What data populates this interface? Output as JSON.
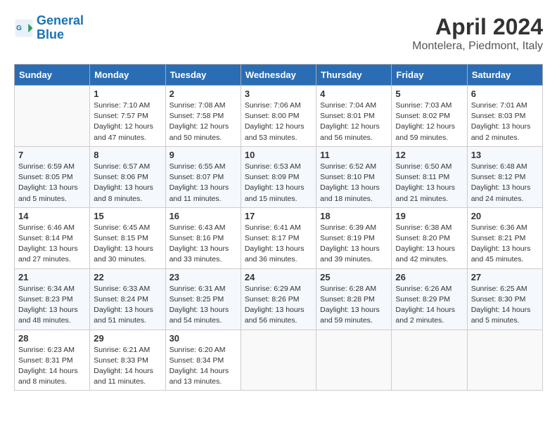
{
  "header": {
    "logo_line1": "General",
    "logo_line2": "Blue",
    "month_title": "April 2024",
    "location": "Montelera, Piedmont, Italy"
  },
  "weekdays": [
    "Sunday",
    "Monday",
    "Tuesday",
    "Wednesday",
    "Thursday",
    "Friday",
    "Saturday"
  ],
  "weeks": [
    [
      {
        "day": "",
        "info": ""
      },
      {
        "day": "1",
        "info": "Sunrise: 7:10 AM\nSunset: 7:57 PM\nDaylight: 12 hours\nand 47 minutes."
      },
      {
        "day": "2",
        "info": "Sunrise: 7:08 AM\nSunset: 7:58 PM\nDaylight: 12 hours\nand 50 minutes."
      },
      {
        "day": "3",
        "info": "Sunrise: 7:06 AM\nSunset: 8:00 PM\nDaylight: 12 hours\nand 53 minutes."
      },
      {
        "day": "4",
        "info": "Sunrise: 7:04 AM\nSunset: 8:01 PM\nDaylight: 12 hours\nand 56 minutes."
      },
      {
        "day": "5",
        "info": "Sunrise: 7:03 AM\nSunset: 8:02 PM\nDaylight: 12 hours\nand 59 minutes."
      },
      {
        "day": "6",
        "info": "Sunrise: 7:01 AM\nSunset: 8:03 PM\nDaylight: 13 hours\nand 2 minutes."
      }
    ],
    [
      {
        "day": "7",
        "info": "Sunrise: 6:59 AM\nSunset: 8:05 PM\nDaylight: 13 hours\nand 5 minutes."
      },
      {
        "day": "8",
        "info": "Sunrise: 6:57 AM\nSunset: 8:06 PM\nDaylight: 13 hours\nand 8 minutes."
      },
      {
        "day": "9",
        "info": "Sunrise: 6:55 AM\nSunset: 8:07 PM\nDaylight: 13 hours\nand 11 minutes."
      },
      {
        "day": "10",
        "info": "Sunrise: 6:53 AM\nSunset: 8:09 PM\nDaylight: 13 hours\nand 15 minutes."
      },
      {
        "day": "11",
        "info": "Sunrise: 6:52 AM\nSunset: 8:10 PM\nDaylight: 13 hours\nand 18 minutes."
      },
      {
        "day": "12",
        "info": "Sunrise: 6:50 AM\nSunset: 8:11 PM\nDaylight: 13 hours\nand 21 minutes."
      },
      {
        "day": "13",
        "info": "Sunrise: 6:48 AM\nSunset: 8:12 PM\nDaylight: 13 hours\nand 24 minutes."
      }
    ],
    [
      {
        "day": "14",
        "info": "Sunrise: 6:46 AM\nSunset: 8:14 PM\nDaylight: 13 hours\nand 27 minutes."
      },
      {
        "day": "15",
        "info": "Sunrise: 6:45 AM\nSunset: 8:15 PM\nDaylight: 13 hours\nand 30 minutes."
      },
      {
        "day": "16",
        "info": "Sunrise: 6:43 AM\nSunset: 8:16 PM\nDaylight: 13 hours\nand 33 minutes."
      },
      {
        "day": "17",
        "info": "Sunrise: 6:41 AM\nSunset: 8:17 PM\nDaylight: 13 hours\nand 36 minutes."
      },
      {
        "day": "18",
        "info": "Sunrise: 6:39 AM\nSunset: 8:19 PM\nDaylight: 13 hours\nand 39 minutes."
      },
      {
        "day": "19",
        "info": "Sunrise: 6:38 AM\nSunset: 8:20 PM\nDaylight: 13 hours\nand 42 minutes."
      },
      {
        "day": "20",
        "info": "Sunrise: 6:36 AM\nSunset: 8:21 PM\nDaylight: 13 hours\nand 45 minutes."
      }
    ],
    [
      {
        "day": "21",
        "info": "Sunrise: 6:34 AM\nSunset: 8:23 PM\nDaylight: 13 hours\nand 48 minutes."
      },
      {
        "day": "22",
        "info": "Sunrise: 6:33 AM\nSunset: 8:24 PM\nDaylight: 13 hours\nand 51 minutes."
      },
      {
        "day": "23",
        "info": "Sunrise: 6:31 AM\nSunset: 8:25 PM\nDaylight: 13 hours\nand 54 minutes."
      },
      {
        "day": "24",
        "info": "Sunrise: 6:29 AM\nSunset: 8:26 PM\nDaylight: 13 hours\nand 56 minutes."
      },
      {
        "day": "25",
        "info": "Sunrise: 6:28 AM\nSunset: 8:28 PM\nDaylight: 13 hours\nand 59 minutes."
      },
      {
        "day": "26",
        "info": "Sunrise: 6:26 AM\nSunset: 8:29 PM\nDaylight: 14 hours\nand 2 minutes."
      },
      {
        "day": "27",
        "info": "Sunrise: 6:25 AM\nSunset: 8:30 PM\nDaylight: 14 hours\nand 5 minutes."
      }
    ],
    [
      {
        "day": "28",
        "info": "Sunrise: 6:23 AM\nSunset: 8:31 PM\nDaylight: 14 hours\nand 8 minutes."
      },
      {
        "day": "29",
        "info": "Sunrise: 6:21 AM\nSunset: 8:33 PM\nDaylight: 14 hours\nand 11 minutes."
      },
      {
        "day": "30",
        "info": "Sunrise: 6:20 AM\nSunset: 8:34 PM\nDaylight: 14 hours\nand 13 minutes."
      },
      {
        "day": "",
        "info": ""
      },
      {
        "day": "",
        "info": ""
      },
      {
        "day": "",
        "info": ""
      },
      {
        "day": "",
        "info": ""
      }
    ]
  ]
}
